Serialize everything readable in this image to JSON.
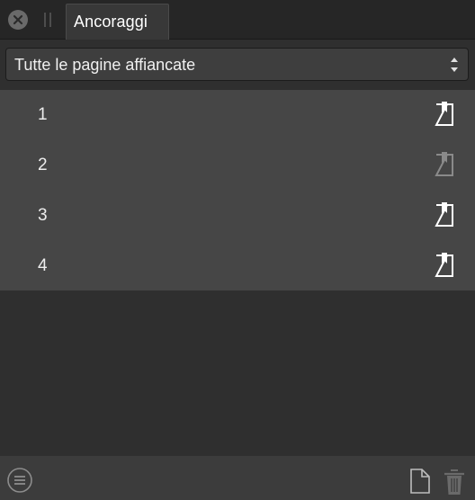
{
  "panel": {
    "tab_title": "Ancoraggi"
  },
  "dropdown": {
    "selected": "Tutte le pagine affiancate"
  },
  "anchors": [
    {
      "label": "1",
      "icon": "anchor-page-icon",
      "state": "active"
    },
    {
      "label": "2",
      "icon": "anchor-page-icon",
      "state": "dimmed"
    },
    {
      "label": "3",
      "icon": "anchor-page-icon",
      "state": "active"
    },
    {
      "label": "4",
      "icon": "anchor-page-icon",
      "state": "active"
    }
  ],
  "toolbar": {
    "menu_icon": "menu-icon",
    "add_icon": "new-document-icon",
    "delete_icon": "trash-icon"
  },
  "colors": {
    "panel_bg": "#2f2f2f",
    "list_bg": "#464646",
    "icon_active": "#ffffff",
    "icon_dimmed": "#8a8a8a"
  }
}
